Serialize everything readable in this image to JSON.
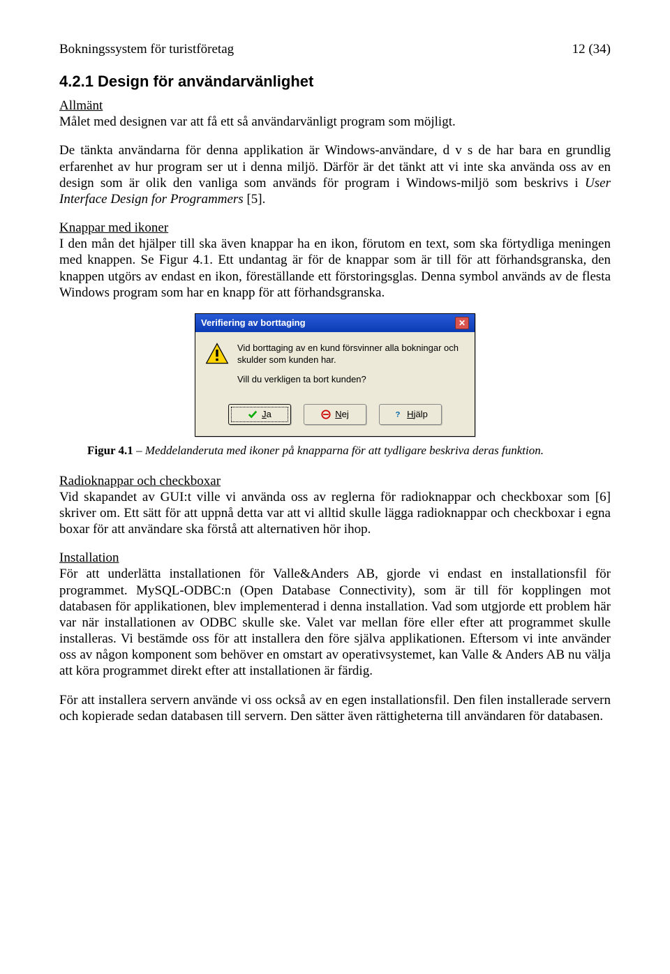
{
  "header": {
    "title": "Bokningssystem för turistföretag",
    "page_indicator": "12 (34)"
  },
  "section": {
    "number_title": "4.2.1  Design för användarvänlighet",
    "allmant_heading": "Allmänt",
    "allmant_p1": "Målet med designen var att få ett så användarvänligt program som möjligt.",
    "allmant_p2a": "De tänkta användarna för denna applikation är Windows-användare, d v s de har bara en grundlig erfarenhet av hur program ser ut i denna miljö. Därför är det tänkt att vi inte ska använda oss av en design som är olik den vanliga som används för program i Windows-miljö som beskrivs i ",
    "allmant_p2_italic": "User Interface Design for Programmers",
    "allmant_p2b": " [5].",
    "knappar_heading": "Knappar med ikoner",
    "knappar_p": "I den mån det hjälper till ska även knappar ha en ikon, förutom en text, som ska förtydliga meningen med knappen. Se Figur 4.1. Ett undantag är för de knappar som är till för att förhandsgranska, den knappen utgörs av endast en ikon, föreställande ett förstoringsglas. Denna symbol används av de flesta Windows program som har en knapp för att förhandsgranska.",
    "radio_heading": "Radioknappar och checkboxar",
    "radio_p": "Vid skapandet av GUI:t ville vi använda oss av reglerna för radioknappar och checkboxar som [6] skriver om. Ett sätt för att uppnå detta var att vi alltid skulle lägga radioknappar och checkboxar i egna boxar för att användare ska förstå att alternativen hör ihop.",
    "install_heading": "Installation",
    "install_p1": "För att underlätta installationen för Valle&Anders AB, gjorde vi endast en installationsfil för programmet. MySQL-ODBC:n (Open Database Connectivity), som är till för kopplingen mot databasen för applikationen, blev implementerad i denna installation. Vad som utgjorde ett problem här var när installationen av ODBC skulle ske. Valet var mellan före eller efter att programmet skulle installeras. Vi bestämde oss för att installera den före själva applikationen. Eftersom vi inte använder oss av någon komponent som behöver en omstart av operativsystemet, kan Valle & Anders AB nu välja att köra programmet direkt efter att installationen är färdig.",
    "install_p2": "För att installera servern använde vi oss också av en egen installationsfil. Den filen installerade servern och kopierade sedan databasen till servern. Den sätter även rättigheterna till användaren för databasen."
  },
  "dialog": {
    "title": "Verifiering av borttaging",
    "line1": "Vid borttaging av en kund försvinner alla bokningar och skulder som kunden har.",
    "line2": "Vill du verkligen ta bort kunden?",
    "buttons": {
      "yes_letter": "J",
      "yes_rest": "a",
      "no_letter": "N",
      "no_rest": "ej",
      "help_letter": "H",
      "help_rest": "jälp"
    }
  },
  "figure": {
    "label": "Figur 4.1",
    "caption_rest": " – Meddelanderuta med ikoner på knapparna för att tydligare beskriva deras funktion."
  }
}
